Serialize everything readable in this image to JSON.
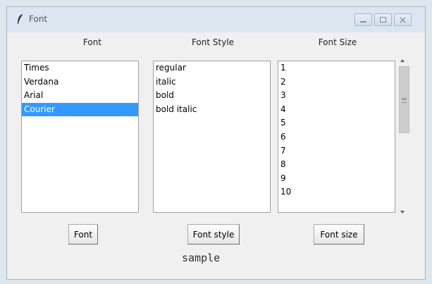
{
  "window": {
    "title": "Font",
    "minimize_icon": "minimize-icon",
    "maximize_icon": "maximize-icon",
    "close_icon": "close-icon"
  },
  "headers": {
    "font": "Font",
    "style": "Font Style",
    "size": "Font Size"
  },
  "font_list": {
    "items": [
      "Times",
      "Verdana",
      "Arial",
      "Courier"
    ],
    "selected": "Courier"
  },
  "style_list": {
    "items": [
      "regular",
      "italic",
      "bold",
      "bold italic"
    ]
  },
  "size_list": {
    "items": [
      "1",
      "2",
      "3",
      "4",
      "5",
      "6",
      "7",
      "8",
      "9",
      "10"
    ]
  },
  "buttons": {
    "font": "Font",
    "style": "Font style",
    "size": "Font size"
  },
  "sample_text": "sample",
  "colors": {
    "selection": "#3399ff",
    "titlebar": "#dce6f1"
  }
}
